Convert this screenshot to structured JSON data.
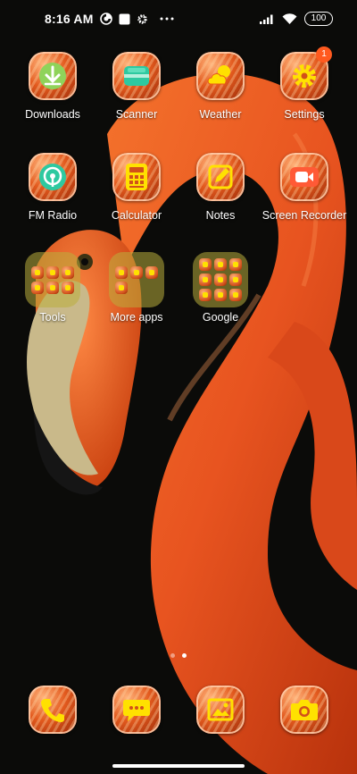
{
  "status_bar": {
    "time": "8:16 AM",
    "battery": "100",
    "icons": [
      "data-saver-icon",
      "square-notification-icon",
      "gear-icon",
      "more-dots-icon",
      "signal-icon",
      "wifi-icon"
    ]
  },
  "apps": [
    {
      "label": "Downloads",
      "icon": "download-icon"
    },
    {
      "label": "Scanner",
      "icon": "scanner-icon"
    },
    {
      "label": "Weather",
      "icon": "weather-icon"
    },
    {
      "label": "Settings",
      "icon": "gear-icon",
      "badge": "1"
    },
    {
      "label": "FM Radio",
      "icon": "radio-icon"
    },
    {
      "label": "Calculator",
      "icon": "calculator-icon"
    },
    {
      "label": "Notes",
      "icon": "notes-icon"
    },
    {
      "label": "Screen Recorder",
      "icon": "video-icon"
    }
  ],
  "folders": [
    {
      "label": "Tools"
    },
    {
      "label": "More apps"
    },
    {
      "label": "Google"
    }
  ],
  "dock": [
    {
      "icon": "phone-icon"
    },
    {
      "icon": "message-icon"
    },
    {
      "icon": "gallery-icon"
    },
    {
      "icon": "camera-icon"
    }
  ],
  "pages": {
    "count": 2,
    "active": 2
  },
  "colors": {
    "icon_glyph": "#ffe100",
    "badge": "#ff5a1f",
    "folder": "#b9af3c"
  }
}
